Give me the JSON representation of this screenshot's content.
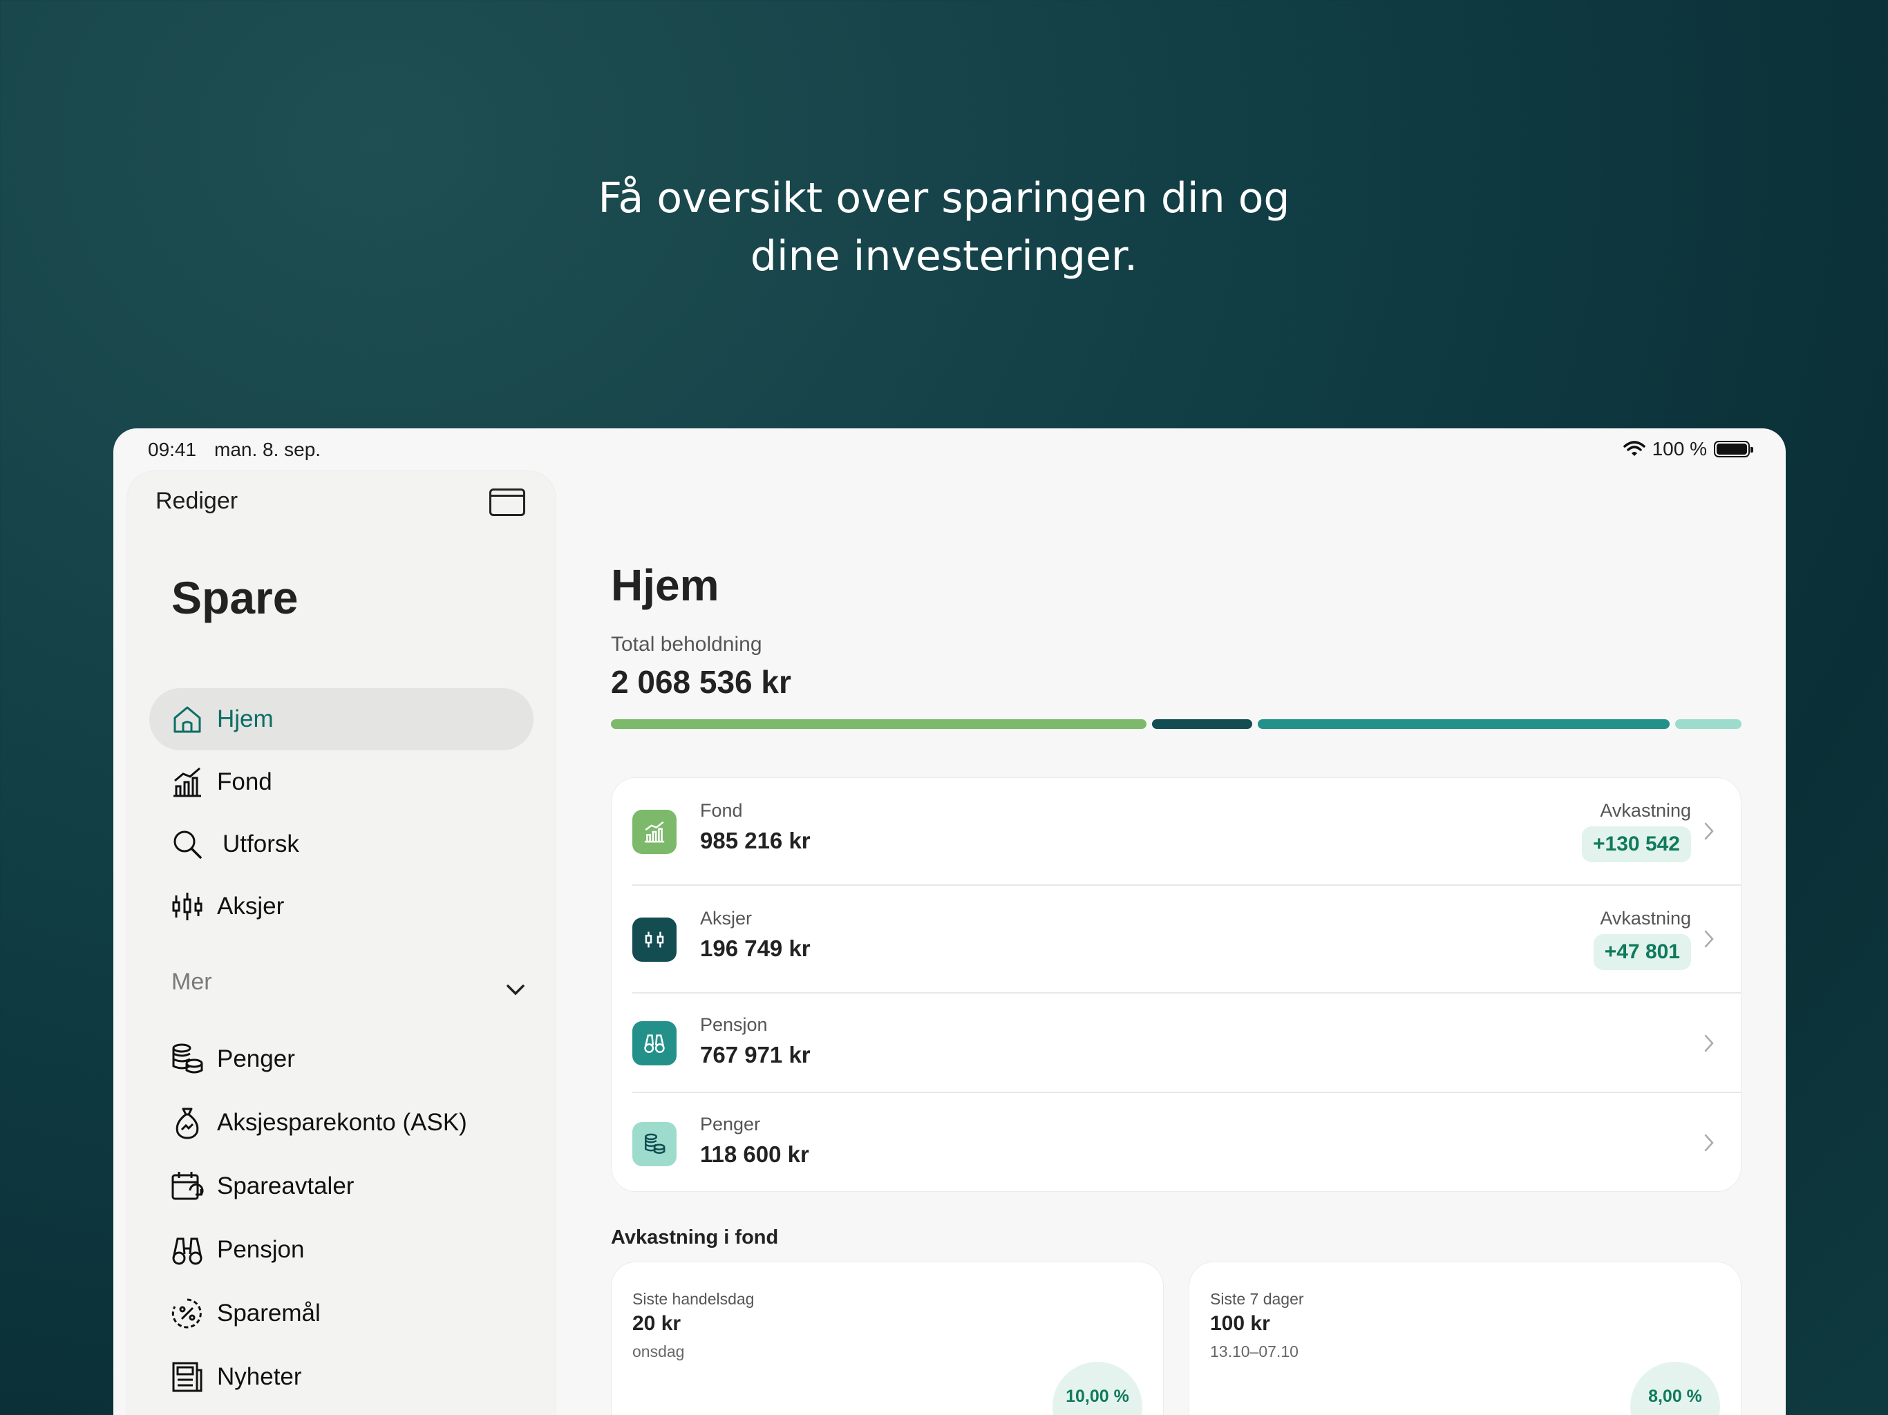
{
  "headline": {
    "line1": "Få oversikt over sparingen din og",
    "line2": "dine investeringer."
  },
  "status": {
    "time": "09:41",
    "date": "man. 8. sep.",
    "battery": "100 %"
  },
  "sidebar": {
    "edit": "Rediger",
    "title": "Spare",
    "items": [
      {
        "label": "Hjem",
        "icon": "house-icon"
      },
      {
        "label": "Fond",
        "icon": "chart-icon"
      },
      {
        "label": "Utforsk",
        "icon": "search-icon"
      },
      {
        "label": "Aksjer",
        "icon": "candlestick-icon"
      }
    ],
    "more_label": "Mer",
    "more_items": [
      {
        "label": "Penger",
        "icon": "coins-icon"
      },
      {
        "label": "Aksjesparekonto (ASK)",
        "icon": "money-bag-icon"
      },
      {
        "label": "Spareavtaler",
        "icon": "calendar-repeat-icon"
      },
      {
        "label": "Pensjon",
        "icon": "binoculars-icon"
      },
      {
        "label": "Sparemål",
        "icon": "percent-goal-icon"
      },
      {
        "label": "Nyheter",
        "icon": "newspaper-icon"
      }
    ]
  },
  "main": {
    "title": "Hjem",
    "total_label": "Total beholdning",
    "total_value": "2 068 536 kr",
    "allocation_colors": [
      "#7cb96b",
      "#134c51",
      "#23918a",
      "#9ddccd"
    ],
    "accounts": [
      {
        "label": "Fond",
        "value": "985 216 kr",
        "return_label": "Avkastning",
        "return_value": "+130 542",
        "icon": "chart-icon",
        "color": "#7cb96b"
      },
      {
        "label": "Aksjer",
        "value": "196 749 kr",
        "return_label": "Avkastning",
        "return_value": "+47 801",
        "icon": "candlestick-icon",
        "color": "#134c51"
      },
      {
        "label": "Pensjon",
        "value": "767 971 kr",
        "icon": "binoculars-icon",
        "color": "#23918a"
      },
      {
        "label": "Penger",
        "value": "118 600 kr",
        "icon": "coins-icon",
        "color": "#9ddccd"
      }
    ],
    "returns_title": "Avkastning i fond",
    "returns": [
      {
        "label": "Siste handelsdag",
        "value": "20 kr",
        "sub": "onsdag",
        "percent": "10,00 %"
      },
      {
        "label": "Siste 7 dager",
        "value": "100 kr",
        "sub": "13.10–07.10",
        "percent": "8,00 %"
      }
    ]
  }
}
